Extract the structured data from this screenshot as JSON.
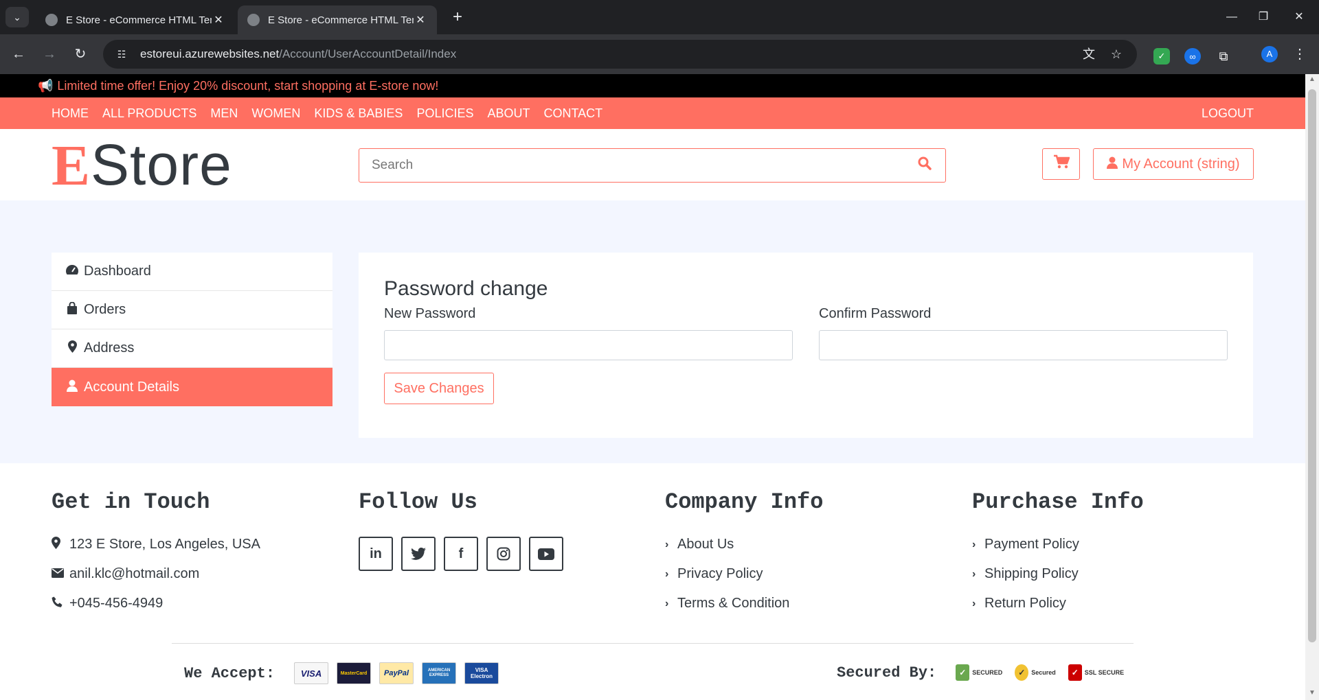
{
  "browser": {
    "tabs": [
      {
        "title": "E Store - eCommerce HTML Template",
        "active": false
      },
      {
        "title": "E Store - eCommerce HTML Template",
        "active": true
      }
    ],
    "url_host": "estoreui.azurewebsites.net",
    "url_path": "/Account/UserAccountDetail/Index",
    "profile_initial": "A"
  },
  "announcement": "Limited time offer! Enjoy 20% discount, start shopping at E-store now!",
  "nav": {
    "links": [
      "HOME",
      "ALL PRODUCTS",
      "MEN",
      "WOMEN",
      "KIDS & BABIES",
      "POLICIES",
      "ABOUT",
      "CONTACT"
    ],
    "logout": "LOGOUT"
  },
  "header": {
    "logo_first": "E",
    "logo_rest": "Store",
    "search_placeholder": "Search",
    "account_label": "My Account (string)"
  },
  "sidebar": {
    "items": [
      {
        "label": "Dashboard",
        "icon": "dashboard-icon"
      },
      {
        "label": "Orders",
        "icon": "shopping-bag-icon"
      },
      {
        "label": "Address",
        "icon": "map-marker-icon"
      },
      {
        "label": "Account Details",
        "icon": "user-icon",
        "active": true
      }
    ]
  },
  "form": {
    "title": "Password change",
    "new_password_label": "New Password",
    "new_password_value": "",
    "confirm_password_label": "Confirm Password",
    "confirm_password_value": "",
    "save_label": "Save Changes"
  },
  "footer": {
    "get_in_touch": {
      "title": "Get in Touch",
      "address": "123 E Store, Los Angeles, USA",
      "email": "anil.klc@hotmail.com",
      "phone": "+045-456-4949"
    },
    "follow_us": {
      "title": "Follow Us",
      "networks": [
        "linkedin-icon",
        "twitter-icon",
        "facebook-icon",
        "instagram-icon",
        "youtube-icon"
      ]
    },
    "company_info": {
      "title": "Company Info",
      "links": [
        "About Us",
        "Privacy Policy",
        "Terms & Condition"
      ]
    },
    "purchase_info": {
      "title": "Purchase Info",
      "links": [
        "Payment Policy",
        "Shipping Policy",
        "Return Policy"
      ]
    },
    "we_accept": "We Accept:",
    "cards": [
      "VISA",
      "MasterCard",
      "PayPal",
      "AMERICAN EXPRESS",
      "VISA Electron"
    ],
    "secured_by": "Secured By:",
    "seals": [
      "SECURED",
      "Secured",
      "SSL SECURE"
    ]
  },
  "colors": {
    "accent": "#ff6f61",
    "dark": "#343a40",
    "content_bg": "#f3f6ff"
  }
}
